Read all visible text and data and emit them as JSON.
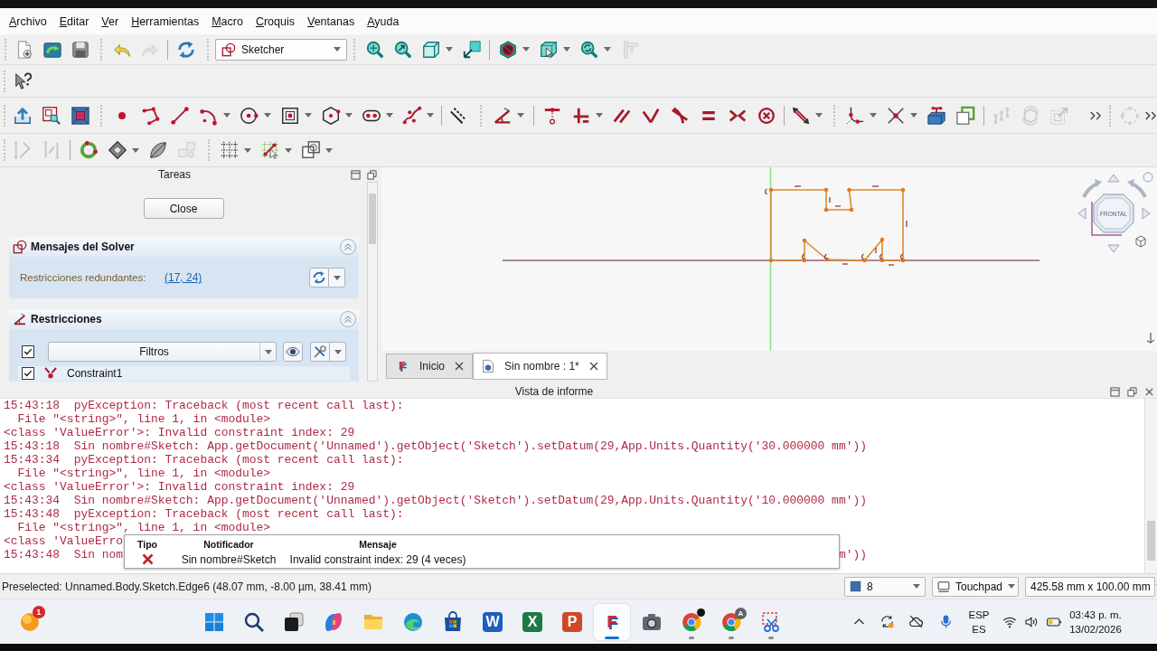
{
  "menu": [
    "Archivo",
    "Editar",
    "Ver",
    "Herramientas",
    "Macro",
    "Croquis",
    "Ventanas",
    "Ayuda"
  ],
  "toolbars": [
    {
      "buttons": [
        {
          "disabled": false
        },
        {
          "disabled": false
        },
        {
          "disabled": false
        },
        {
          "disabled": false
        },
        {
          "disabled": true
        },
        {
          "disabled": false
        },
        {
          "disabled": false
        },
        {
          "disabled": false
        },
        {
          "disabled": false
        },
        {
          "disabled": false
        },
        {
          "disabled": false
        },
        {
          "disabled": false
        },
        {
          "disabled": false
        },
        {
          "disabled": true
        }
      ]
    },
    {
      "buttons": [
        {
          "disabled": false
        }
      ]
    },
    {
      "buttons": [
        {
          "disabled": false
        },
        {
          "disabled": false
        },
        {
          "disabled": false
        },
        {
          "disabled": false
        },
        {
          "disabled": false
        },
        {
          "disabled": false
        },
        {
          "disabled": false
        },
        {
          "disabled": false
        },
        {
          "disabled": false
        },
        {
          "disabled": false
        },
        {
          "disabled": false
        },
        {
          "disabled": false
        },
        {
          "disabled": false
        },
        {
          "disabled": false
        },
        {
          "disabled": false
        },
        {
          "disabled": false
        },
        {
          "disabled": false
        },
        {
          "disabled": false
        },
        {
          "disabled": false
        },
        {
          "disabled": false
        },
        {
          "disabled": false
        },
        {
          "disabled": false
        },
        {
          "disabled": false
        },
        {
          "disabled": false
        },
        {
          "disabled": false
        },
        {
          "disabled": false
        },
        {
          "disabled": false
        },
        {
          "disabled": true
        },
        {
          "disabled": true
        },
        {
          "disabled": true
        },
        {
          "disabled": false
        },
        {
          "disabled": true
        },
        {
          "disabled": false
        }
      ]
    },
    {
      "buttons": [
        {
          "disabled": true
        },
        {
          "disabled": true
        },
        {
          "disabled": false
        },
        {
          "disabled": false
        },
        {
          "disabled": false
        },
        {
          "disabled": true
        },
        {
          "disabled": false
        },
        {
          "disabled": false
        },
        {
          "disabled": false
        }
      ]
    }
  ],
  "workbench": "Sketcher",
  "tasks": {
    "title": "Tareas",
    "close_button": "Close",
    "solver": {
      "title": "Mensajes del Solver",
      "expanded": true,
      "label": "Restricciones redundantes:",
      "link": "(17, 24)"
    },
    "constraints": {
      "title": "Restricciones",
      "expanded": true,
      "filter_checked": true,
      "filter": "Filtros",
      "items": [
        {
          "name": "Constraint1",
          "checked": true
        }
      ]
    }
  },
  "navigation_cube": {
    "face": "FRONTAL"
  },
  "view_tabs": [
    {
      "label": "Inicio",
      "logo": "F",
      "selected": false
    },
    {
      "label": "Sin nombre : 1*",
      "selected": true
    }
  ],
  "report": {
    "title": "Vista de informe",
    "lines": [
      {
        "text": "15:43:18  pyException: Traceback (most recent call last):"
      },
      {
        "text": "  File \"<string>\", line 1, in <module>"
      },
      {
        "text": "<class 'ValueError'>: Invalid constraint index: 29"
      },
      {
        "text": "15:43:18  Sin nombre#Sketch: App.getDocument('Unnamed').getObject('Sketch').setDatum(29,App.Units.Quantity('30.000000 mm'))"
      },
      {
        "text": "15:43:34  pyException: Traceback (most recent call last):"
      },
      {
        "text": "  File \"<string>\", line 1, in <module>"
      },
      {
        "text": "<class 'ValueError'>: Invalid constraint index: 29"
      },
      {
        "text": "15:43:34  Sin nombre#Sketch: App.getDocument('Unnamed').getObject('Sketch').setDatum(29,App.Units.Quantity('10.000000 mm'))"
      },
      {
        "text": "15:43:48  pyException: Traceback (most recent call last):"
      },
      {
        "text": "  File \"<string>\", line 1, in <module>"
      },
      {
        "text": "<class 'ValueErro"
      },
      {
        "text": "15:43:48  Sin nom",
        "tail": "m'))"
      }
    ],
    "notification": {
      "columns": [
        "Tipo",
        "Notificador",
        "Mensaje"
      ],
      "rows": [
        {
          "kind": "error",
          "notifier": "Sin nombre#Sketch",
          "message": "Invalid constraint index: 29 (4 veces)"
        }
      ]
    }
  },
  "status_bar": {
    "message": "Preselected: Unnamed.Body.Sketch.Edge6 (48.07 mm, -8.00 µm, 38.41 mm)",
    "draw_style": "8",
    "navigation": "Touchpad",
    "dimensions": "425.58 mm x 100.00 mm"
  },
  "taskbar": {
    "widget_badge": "1",
    "apps": [
      {
        "active": false,
        "running": false
      },
      {
        "active": false,
        "running": false
      },
      {
        "active": false,
        "running": false
      },
      {
        "active": false,
        "running": false
      },
      {
        "active": false,
        "running": false
      },
      {
        "active": false,
        "running": false
      },
      {
        "active": false,
        "running": false
      },
      {
        "label": "W",
        "active": false,
        "running": false
      },
      {
        "label": "X",
        "active": false,
        "running": false
      },
      {
        "label": "P",
        "active": false,
        "running": false
      },
      {
        "label": "F",
        "active": true,
        "running": true
      },
      {
        "active": false,
        "running": false
      },
      {
        "active": false,
        "running": true
      },
      {
        "badge": "A",
        "active": false,
        "running": true
      },
      {
        "active": false,
        "running": true
      }
    ],
    "language": "ESP",
    "region": "ES",
    "time": "03:43 p. m.",
    "date": "13/02/2026"
  }
}
